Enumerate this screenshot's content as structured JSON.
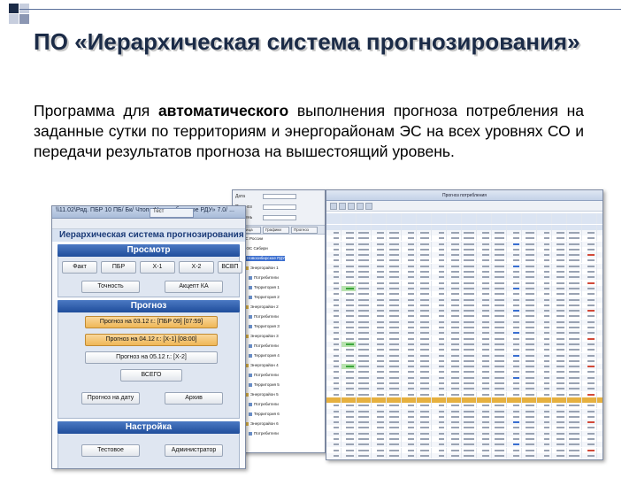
{
  "slide": {
    "title": "ПО «Иерархическая система прогнозирования»",
    "body_pre": "Программа для ",
    "body_bold": "автоматического",
    "body_post": " выполнения прогноза потребления на заданные сутки по территориям и энергорайонам ЭС на всех уровнях СО и передачи результатов прогноза на вышестоящий уровень.",
    "accent_color": "#1b2b47",
    "deco_colors": [
      "#1b2b47",
      "#8c97b3",
      "#c7cede"
    ]
  },
  "window1": {
    "title_text": "\\\\11.02\\Ряд. ПБР 10 ПБ/ Бк/ Чтоп «Новосибирское РДУ» 7.0/ ...",
    "tab_label": "Тест",
    "header": "Иерархическая система прогнозирования (И",
    "sections": {
      "view": "Просмотр",
      "forecast": "Прогноз",
      "settings": "Настройка"
    },
    "view_buttons": [
      "Факт",
      "ПБР",
      "Х-1",
      "Х-2",
      "ВСВП",
      "Точность",
      "Акцепт КА"
    ],
    "forecast_buttons": [
      "Прогноз на 03.12 г.: [ПБР 09] [07:59]",
      "Прогноз на 04.12 г.: [Х-1] [08:00]",
      "Прогноз на 05.12 г.: [Х-2]",
      "ВСЕГО",
      "Прогноз на дату",
      "Архив"
    ],
    "settings_buttons": [
      "Тестовое",
      "Администратор"
    ]
  },
  "window2": {
    "fields": [
      "Дата",
      "Прогноз",
      "Уровень"
    ],
    "tabs": [
      "Таблица",
      "Графики",
      "Прогноз"
    ],
    "tree": [
      "ЕЭС России",
      "ОЭС Сибири",
      "Новосибирское РДУ",
      "Энергорайон 1",
      "Потребители",
      "Территория 1",
      "Территория 2",
      "Энергорайон 2",
      "Потребители",
      "Территория 3",
      "Энергорайон 3",
      "Потребители",
      "Территория 4",
      "Энергорайон 4",
      "Потребители",
      "Территория 5",
      "Энергорайон 5",
      "Потребители",
      "Территория 6",
      "Энергорайон 6",
      "Потребители"
    ]
  },
  "window3": {
    "title_text": "Прогноз потребления"
  }
}
